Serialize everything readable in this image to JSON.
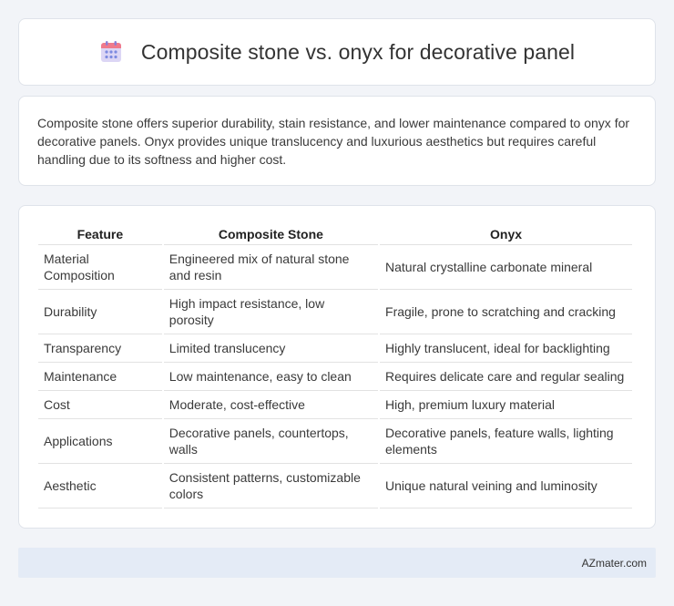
{
  "header": {
    "icon": "calendar-icon",
    "title": "Composite stone vs. onyx for decorative panel"
  },
  "summary": {
    "text": "Composite stone offers superior durability, stain resistance, and lower maintenance compared to onyx for decorative panels. Onyx provides unique translucency and luxurious aesthetics but requires careful handling due to its softness and higher cost."
  },
  "table": {
    "headers": [
      "Feature",
      "Composite Stone",
      "Onyx"
    ],
    "rows": [
      [
        "Material Composition",
        "Engineered mix of natural stone and resin",
        "Natural crystalline carbonate mineral"
      ],
      [
        "Durability",
        "High impact resistance, low porosity",
        "Fragile, prone to scratching and cracking"
      ],
      [
        "Transparency",
        "Limited translucency",
        "Highly translucent, ideal for backlighting"
      ],
      [
        "Maintenance",
        "Low maintenance, easy to clean",
        "Requires delicate care and regular sealing"
      ],
      [
        "Cost",
        "Moderate, cost-effective",
        "High, premium luxury material"
      ],
      [
        "Applications",
        "Decorative panels, countertops, walls",
        "Decorative panels, feature walls, lighting elements"
      ],
      [
        "Aesthetic",
        "Consistent patterns, customizable colors",
        "Unique natural veining and luminosity"
      ]
    ]
  },
  "footer": {
    "source": "AZmater.com"
  },
  "colors": {
    "page_background": "#f2f4f8",
    "card_background": "#ffffff",
    "footer_background": "#e4ebf6",
    "icon_header": "#f07a8c",
    "icon_body": "#dcd6f5",
    "icon_dots": "#7d8be0"
  }
}
